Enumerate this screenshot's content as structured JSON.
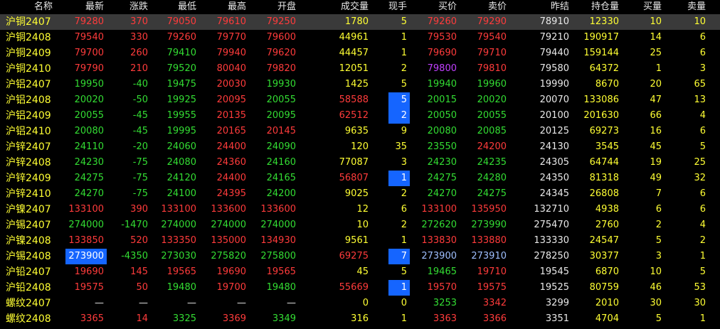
{
  "headers": [
    "名称",
    "最新",
    "涨跌",
    "最低",
    "最高",
    "开盘",
    "成交量",
    "现手",
    "买价",
    "卖价",
    "昨结",
    "持仓量",
    "买量",
    "卖量"
  ],
  "rows": [
    {
      "name": "沪铜2407",
      "last": "79280",
      "chg": "370",
      "low": "79050",
      "high": "79610",
      "open": "79250",
      "vol": "1780",
      "cur": "5",
      "bid": "79260",
      "ask": "79290",
      "pre": "78910",
      "oi": "12330",
      "bq": "10",
      "aq": "10",
      "selected": true,
      "dir": "up"
    },
    {
      "name": "沪铜2408",
      "last": "79540",
      "chg": "330",
      "low": "79260",
      "high": "79770",
      "open": "79600",
      "vol": "44961",
      "cur": "1",
      "bid": "79530",
      "ask": "79540",
      "pre": "79210",
      "oi": "190917",
      "bq": "14",
      "aq": "6",
      "dir": "up"
    },
    {
      "name": "沪铜2409",
      "last": "79700",
      "chg": "260",
      "low": "79410",
      "high": "79940",
      "open": "79620",
      "vol": "44457",
      "cur": "1",
      "bid": "79690",
      "ask": "79710",
      "pre": "79440",
      "oi": "159144",
      "bq": "25",
      "aq": "6",
      "dir": "up"
    },
    {
      "name": "沪铜2410",
      "last": "79790",
      "chg": "210",
      "low": "79520",
      "high": "80040",
      "open": "79820",
      "vol": "12051",
      "cur": "2",
      "bid": "79800",
      "ask": "79810",
      "pre": "79580",
      "oi": "64372",
      "bq": "1",
      "aq": "3",
      "dir": "up"
    },
    {
      "name": "沪铝2407",
      "last": "19950",
      "chg": "-40",
      "low": "19475",
      "high": "20030",
      "open": "19930",
      "vol": "1425",
      "cur": "5",
      "bid": "19940",
      "ask": "19960",
      "pre": "19990",
      "oi": "8670",
      "bq": "20",
      "aq": "65",
      "dir": "dn"
    },
    {
      "name": "沪铝2408",
      "last": "20020",
      "chg": "-50",
      "low": "19925",
      "high": "20095",
      "open": "20055",
      "vol": "58588",
      "cur": "5",
      "bid": "20015",
      "ask": "20020",
      "pre": "20070",
      "oi": "133086",
      "bq": "47",
      "aq": "13",
      "dir": "dn"
    },
    {
      "name": "沪铝2409",
      "last": "20055",
      "chg": "-45",
      "low": "19955",
      "high": "20135",
      "open": "20095",
      "vol": "62512",
      "cur": "2",
      "bid": "20050",
      "ask": "20055",
      "pre": "20100",
      "oi": "201630",
      "bq": "66",
      "aq": "4",
      "dir": "dn"
    },
    {
      "name": "沪铝2410",
      "last": "20080",
      "chg": "-45",
      "low": "19995",
      "high": "20165",
      "open": "20145",
      "vol": "9635",
      "cur": "9",
      "bid": "20080",
      "ask": "20085",
      "pre": "20125",
      "oi": "69273",
      "bq": "16",
      "aq": "6",
      "dir": "dn"
    },
    {
      "name": "沪锌2407",
      "last": "24110",
      "chg": "-20",
      "low": "24060",
      "high": "24400",
      "open": "24090",
      "vol": "120",
      "cur": "35",
      "bid": "23550",
      "ask": "24200",
      "pre": "24130",
      "oi": "3545",
      "bq": "45",
      "aq": "5",
      "dir": "dn"
    },
    {
      "name": "沪锌2408",
      "last": "24230",
      "chg": "-75",
      "low": "24080",
      "high": "24360",
      "open": "24160",
      "vol": "77087",
      "cur": "3",
      "bid": "24230",
      "ask": "24235",
      "pre": "24305",
      "oi": "64744",
      "bq": "19",
      "aq": "25",
      "dir": "dn"
    },
    {
      "name": "沪锌2409",
      "last": "24275",
      "chg": "-75",
      "low": "24120",
      "high": "24400",
      "open": "24165",
      "vol": "56807",
      "cur": "1",
      "bid": "24275",
      "ask": "24280",
      "pre": "24350",
      "oi": "81318",
      "bq": "49",
      "aq": "32",
      "dir": "dn"
    },
    {
      "name": "沪锌2410",
      "last": "24270",
      "chg": "-75",
      "low": "24100",
      "high": "24395",
      "open": "24200",
      "vol": "9025",
      "cur": "2",
      "bid": "24270",
      "ask": "24275",
      "pre": "24345",
      "oi": "26808",
      "bq": "7",
      "aq": "6",
      "dir": "dn"
    },
    {
      "name": "沪镍2407",
      "last": "133100",
      "chg": "390",
      "low": "133100",
      "high": "133600",
      "open": "133600",
      "vol": "12",
      "cur": "6",
      "bid": "133100",
      "ask": "135950",
      "pre": "132710",
      "oi": "4938",
      "bq": "6",
      "aq": "6",
      "dir": "up"
    },
    {
      "name": "沪锡2407",
      "last": "274000",
      "chg": "-1470",
      "low": "274000",
      "high": "274000",
      "open": "274000",
      "vol": "10",
      "cur": "2",
      "bid": "272620",
      "ask": "273990",
      "pre": "275470",
      "oi": "2760",
      "bq": "2",
      "aq": "4",
      "dir": "dn"
    },
    {
      "name": "沪镍2408",
      "last": "133850",
      "chg": "520",
      "low": "133350",
      "high": "135000",
      "open": "134930",
      "vol": "9561",
      "cur": "1",
      "bid": "133830",
      "ask": "133880",
      "pre": "133330",
      "oi": "24547",
      "bq": "5",
      "aq": "2",
      "dir": "up"
    },
    {
      "name": "沪锡2408",
      "last": "273900",
      "chg": "-4350",
      "low": "273030",
      "high": "275820",
      "open": "275800",
      "vol": "69275",
      "cur": "7",
      "bid": "273900",
      "ask": "273910",
      "pre": "278250",
      "oi": "30377",
      "bq": "3",
      "aq": "1",
      "dir": "dn"
    },
    {
      "name": "沪铅2407",
      "last": "19690",
      "chg": "145",
      "low": "19565",
      "high": "19690",
      "open": "19565",
      "vol": "45",
      "cur": "5",
      "bid": "19465",
      "ask": "19710",
      "pre": "19545",
      "oi": "6870",
      "bq": "10",
      "aq": "5",
      "dir": "up"
    },
    {
      "name": "沪铅2408",
      "last": "19575",
      "chg": "50",
      "low": "19480",
      "high": "19700",
      "open": "19480",
      "vol": "55669",
      "cur": "1",
      "bid": "19570",
      "ask": "19575",
      "pre": "19525",
      "oi": "80759",
      "bq": "46",
      "aq": "53",
      "dir": "up"
    },
    {
      "name": "螺纹2407",
      "last": "—",
      "chg": "—",
      "low": "—",
      "high": "—",
      "open": "—",
      "vol": "0",
      "cur": "0",
      "bid": "3253",
      "ask": "3342",
      "pre": "3299",
      "oi": "2010",
      "bq": "30",
      "aq": "30",
      "dir": "none"
    },
    {
      "name": "螺纹2408",
      "last": "3365",
      "chg": "14",
      "low": "3325",
      "high": "3369",
      "open": "3349",
      "vol": "316",
      "cur": "1",
      "bid": "3363",
      "ask": "3366",
      "pre": "3351",
      "oi": "4704",
      "bq": "5",
      "aq": "1",
      "dir": "up"
    }
  ],
  "colors": {
    "up": "#ff3b3b",
    "down": "#33dd33",
    "volume": "#ffff33",
    "flat": "#e8e8e8",
    "highlight": "#1565ff",
    "selected_row": "#3a3a3a"
  }
}
